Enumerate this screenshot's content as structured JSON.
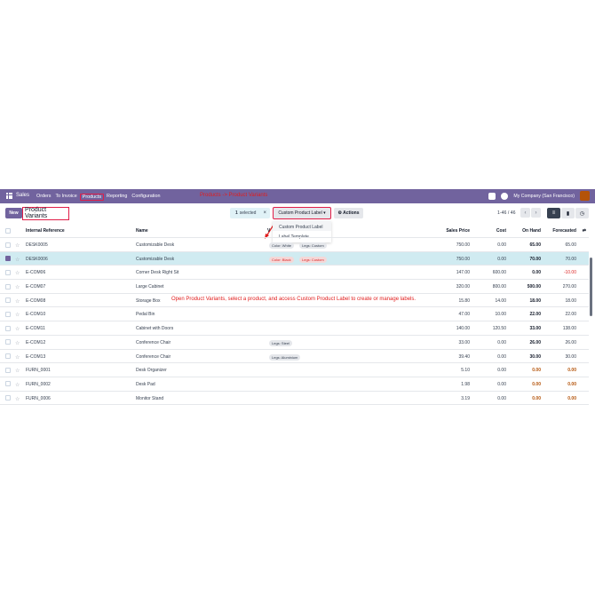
{
  "nav": {
    "brand": "Sales",
    "menu": [
      "Orders",
      "To Invoice",
      "Products",
      "Reporting",
      "Configuration"
    ],
    "active_index": 2,
    "annotation": "Products -> Product Variants",
    "company": "My Company (San Francisco)",
    "chat_badge": "",
    "activity_badge": ""
  },
  "cp": {
    "new_label": "New",
    "breadcrumb": "Product Variants",
    "selected_count": "1",
    "selected_label": "selected",
    "close_glyph": "×",
    "custom_label_button": "Custom Product Label ▾",
    "actions_label": "⚙ Actions",
    "pager": "1-46 / 46",
    "prev": "‹",
    "next": "›"
  },
  "dropdown": {
    "items": [
      "Custom Product Label",
      "Label Template"
    ]
  },
  "annotation_main": "Open Product Variants, select a product, and access Custom Product Label to create or manage labels.",
  "table": {
    "headers": {
      "ref": "Internal Reference",
      "name": "Name",
      "values": "V",
      "price": "Sales Price",
      "cost": "Cost",
      "onhand": "On Hand",
      "forecast": "Forecasted",
      "settings_icon": "⇄"
    },
    "rows": [
      {
        "ref": "DESK0005",
        "name": "Customizable Desk",
        "tags": [
          "Color: White",
          "Legs: Custom"
        ],
        "price": "750.00",
        "cost": "0.00",
        "onhand": "65.00",
        "forecast": "65.00",
        "selected": false
      },
      {
        "ref": "DESK0006",
        "name": "Customizable Desk",
        "tags": [
          "Color: Black",
          "Legs: Custom"
        ],
        "price": "750.00",
        "cost": "0.00",
        "onhand": "70.00",
        "forecast": "70.00",
        "selected": true
      },
      {
        "ref": "E-COM06",
        "name": "Corner Desk Right Sit",
        "tags": [],
        "price": "147.00",
        "cost": "600.00",
        "onhand": "0.00",
        "forecast": "-10.00",
        "selected": false
      },
      {
        "ref": "E-COM07",
        "name": "Large Cabinet",
        "tags": [],
        "price": "320.00",
        "cost": "800.00",
        "onhand": "500.00",
        "forecast": "270.00",
        "selected": false
      },
      {
        "ref": "E-COM08",
        "name": "Storage Box",
        "tags": [],
        "price": "15.80",
        "cost": "14.00",
        "onhand": "18.00",
        "forecast": "18.00",
        "selected": false
      },
      {
        "ref": "E-COM10",
        "name": "Pedal Bin",
        "tags": [],
        "price": "47.00",
        "cost": "10.00",
        "onhand": "22.00",
        "forecast": "22.00",
        "selected": false
      },
      {
        "ref": "E-COM11",
        "name": "Cabinet with Doors",
        "tags": [],
        "price": "140.00",
        "cost": "120.50",
        "onhand": "33.00",
        "forecast": "138.00",
        "selected": false
      },
      {
        "ref": "E-COM12",
        "name": "Conference Chair",
        "tags": [
          "Legs: Steel"
        ],
        "price": "33.00",
        "cost": "0.00",
        "onhand": "26.00",
        "forecast": "26.00",
        "selected": false
      },
      {
        "ref": "E-COM13",
        "name": "Conference Chair",
        "tags": [
          "Legs: Aluminium"
        ],
        "price": "39.40",
        "cost": "0.00",
        "onhand": "30.00",
        "forecast": "30.00",
        "selected": false
      },
      {
        "ref": "FURN_0001",
        "name": "Desk Organizer",
        "tags": [],
        "price": "5.10",
        "cost": "0.00",
        "onhand": "0.00",
        "forecast": "0.00",
        "selected": false
      },
      {
        "ref": "FURN_0002",
        "name": "Desk Pad",
        "tags": [],
        "price": "1.98",
        "cost": "0.00",
        "onhand": "0.00",
        "forecast": "0.00",
        "selected": false
      },
      {
        "ref": "FURN_0006",
        "name": "Monitor Stand",
        "tags": [],
        "price": "3.19",
        "cost": "0.00",
        "onhand": "0.00",
        "forecast": "0.00",
        "selected": false
      }
    ]
  },
  "colors": {
    "brand": "#71639e",
    "selected_row": "#d0ebf1",
    "annotation": "#e11d1d",
    "negative": "#dc2626"
  }
}
